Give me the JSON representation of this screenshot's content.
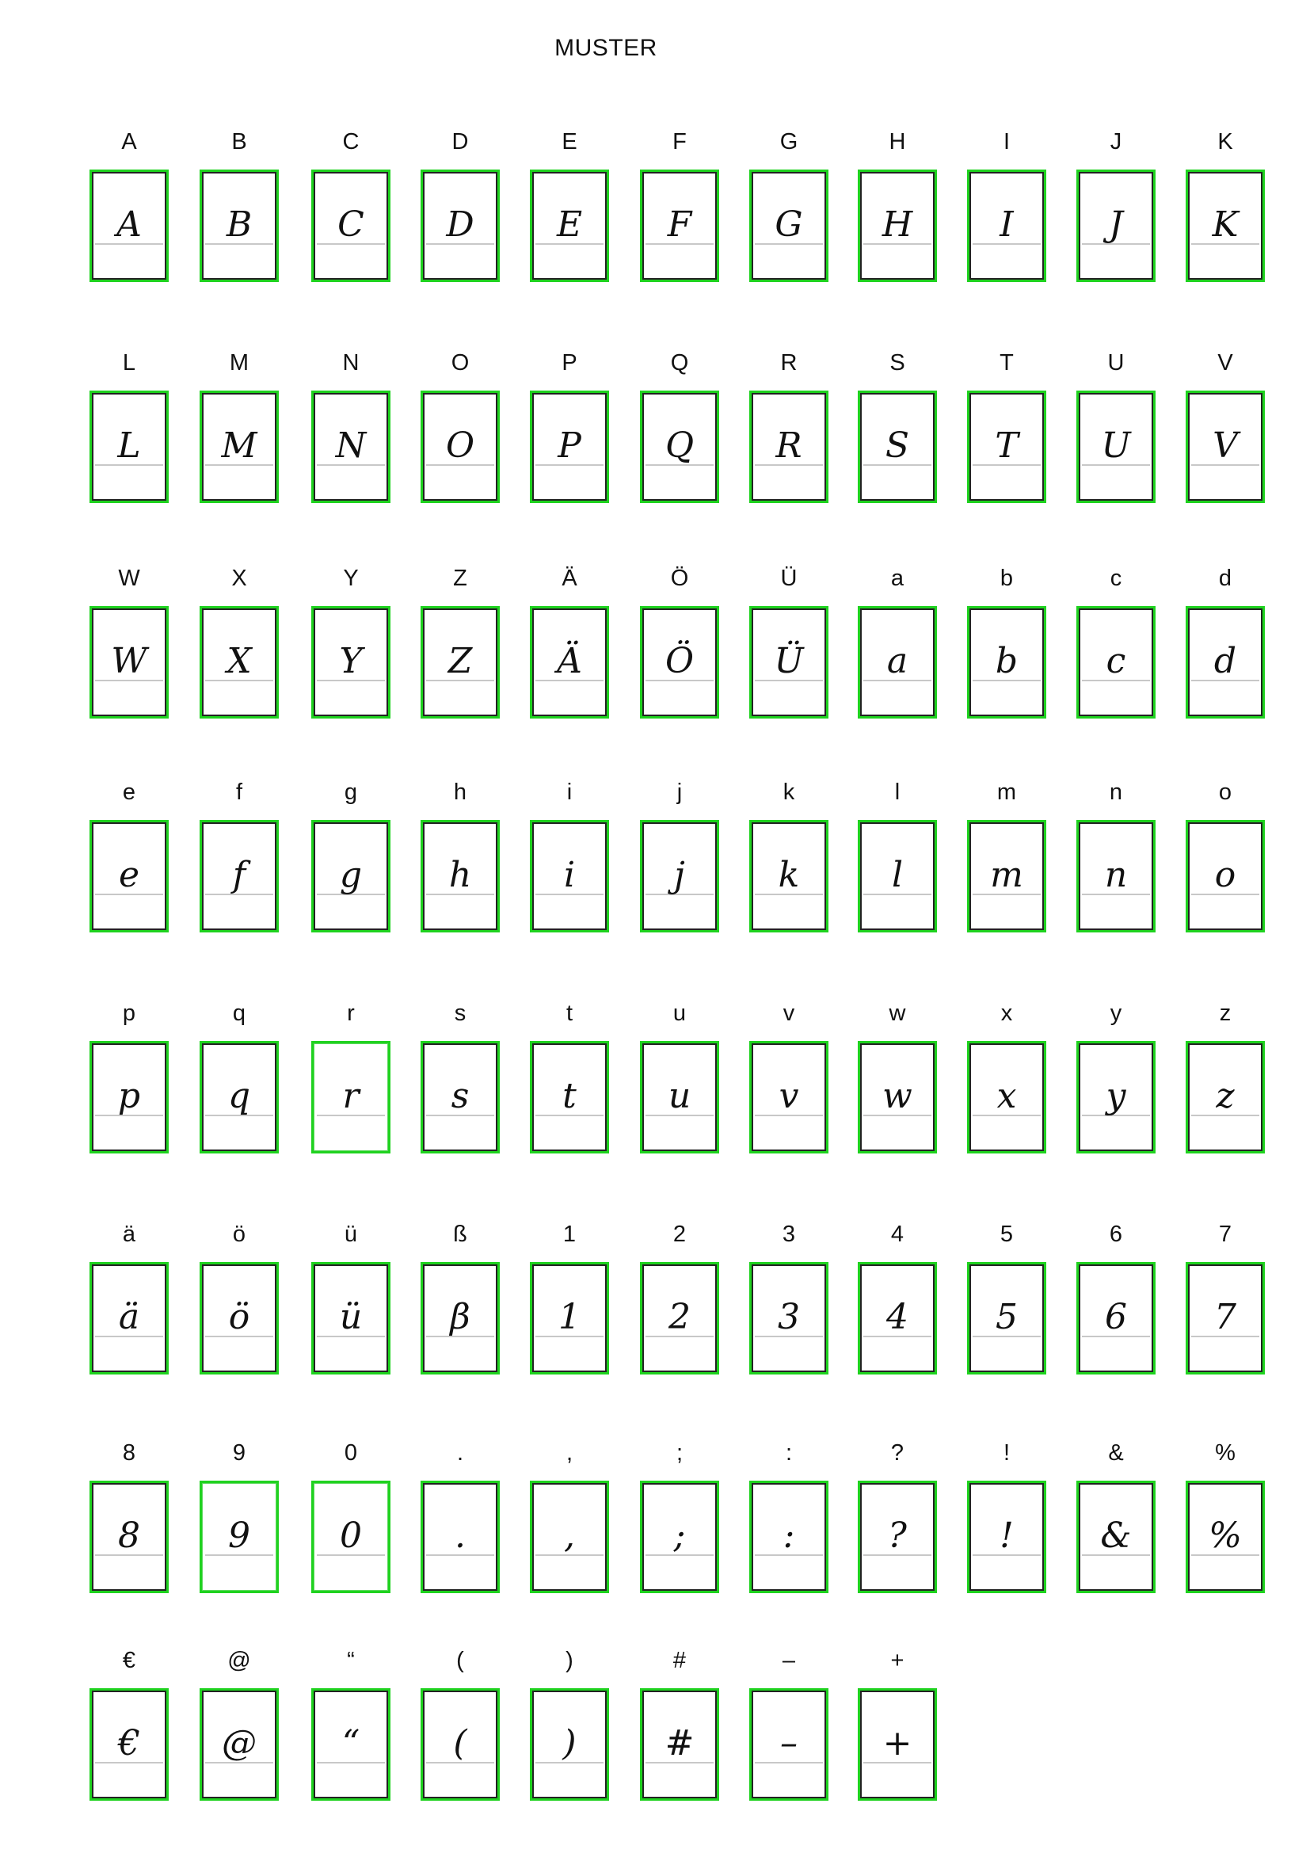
{
  "title": "MUSTER",
  "rows": [
    [
      "A",
      "B",
      "C",
      "D",
      "E",
      "F",
      "G",
      "H",
      "I",
      "J",
      "K"
    ],
    [
      "L",
      "M",
      "N",
      "O",
      "P",
      "Q",
      "R",
      "S",
      "T",
      "U",
      "V"
    ],
    [
      "W",
      "X",
      "Y",
      "Z",
      "Ä",
      "Ö",
      "Ü",
      "a",
      "b",
      "c",
      "d"
    ],
    [
      "e",
      "f",
      "g",
      "h",
      "i",
      "j",
      "k",
      "l",
      "m",
      "n",
      "o"
    ],
    [
      "p",
      "q",
      "r",
      "s",
      "t",
      "u",
      "v",
      "w",
      "x",
      "y",
      "z"
    ],
    [
      "ä",
      "ö",
      "ü",
      "ß",
      "1",
      "2",
      "3",
      "4",
      "5",
      "6",
      "7"
    ],
    [
      "8",
      "9",
      "0",
      ".",
      ",",
      ";",
      ":",
      "?",
      "!",
      "&",
      "%"
    ],
    [
      "€",
      "@",
      "“",
      "(",
      ")",
      "#",
      "–",
      "+"
    ]
  ],
  "handwritten": [
    [
      "A",
      "B",
      "C",
      "D",
      "E",
      "F",
      "G",
      "H",
      "I",
      "J",
      "K"
    ],
    [
      "L",
      "M",
      "N",
      "O",
      "P",
      "Q",
      "R",
      "S",
      "T",
      "U",
      "V"
    ],
    [
      "W",
      "X",
      "Y",
      "Z",
      "Ä",
      "Ö",
      "Ü",
      "a",
      "b",
      "c",
      "d"
    ],
    [
      "e",
      "f",
      "g",
      "h",
      "i",
      "j",
      "k",
      "l",
      "m",
      "n",
      "o"
    ],
    [
      "p",
      "q",
      "r",
      "s",
      "t",
      "u",
      "v",
      "w",
      "x",
      "y",
      "z"
    ],
    [
      "ä",
      "ö",
      "ü",
      "β",
      "1",
      "2",
      "3",
      "4",
      "5",
      "6",
      "7"
    ],
    [
      "8",
      "9",
      "0",
      ".",
      ",",
      ";",
      ":",
      "?",
      "!",
      "&",
      "%"
    ],
    [
      "€",
      "@",
      "“",
      "(",
      ")",
      "#",
      "–",
      "+"
    ]
  ],
  "colors": {
    "box_border": "#1fd21f",
    "guide_line": "#c8c8c8",
    "text": "#111111"
  }
}
